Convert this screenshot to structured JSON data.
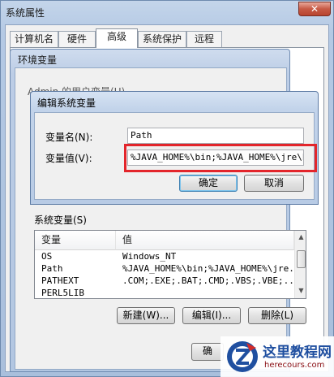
{
  "system_properties": {
    "title": "系统属性",
    "close_glyph": "✕",
    "tabs": [
      "计算机名",
      "硬件",
      "高级",
      "系统保护",
      "远程"
    ],
    "active_tab": "高级"
  },
  "env_vars": {
    "title": "环境变量",
    "user_vars_label": "Admin 的用户变量(U)",
    "system_vars_label": "系统变量(S)",
    "columns": [
      "变量",
      "值"
    ],
    "rows": [
      {
        "name": "OS",
        "value": "Windows_NT"
      },
      {
        "name": "Path",
        "value": "%JAVA_HOME%\\bin;%JAVA_HOME%\\jre..."
      },
      {
        "name": "PATHEXT",
        "value": ".COM;.EXE;.BAT;.CMD;.VBS;.VBE;..."
      },
      {
        "name": "PERL5LIB",
        "value": ""
      }
    ],
    "buttons": {
      "new": "新建(W)...",
      "edit": "编辑(I)...",
      "delete": "删除(L)"
    },
    "ok_partial": "确"
  },
  "edit_dialog": {
    "title": "编辑系统变量",
    "var_name_label": "变量名(N):",
    "var_name_value": "Path",
    "var_value_label": "变量值(V):",
    "var_value_value": "%JAVA_HOME%\\bin;%JAVA_HOME%\\jre\\bin",
    "ok": "确定",
    "cancel": "取消"
  },
  "watermark": {
    "text": "这里教程网",
    "url": "herecours.com"
  },
  "colors": {
    "highlight": "#e3252b",
    "title_gradient": "#bccde6",
    "watermark_blue": "#1f4fa0"
  }
}
